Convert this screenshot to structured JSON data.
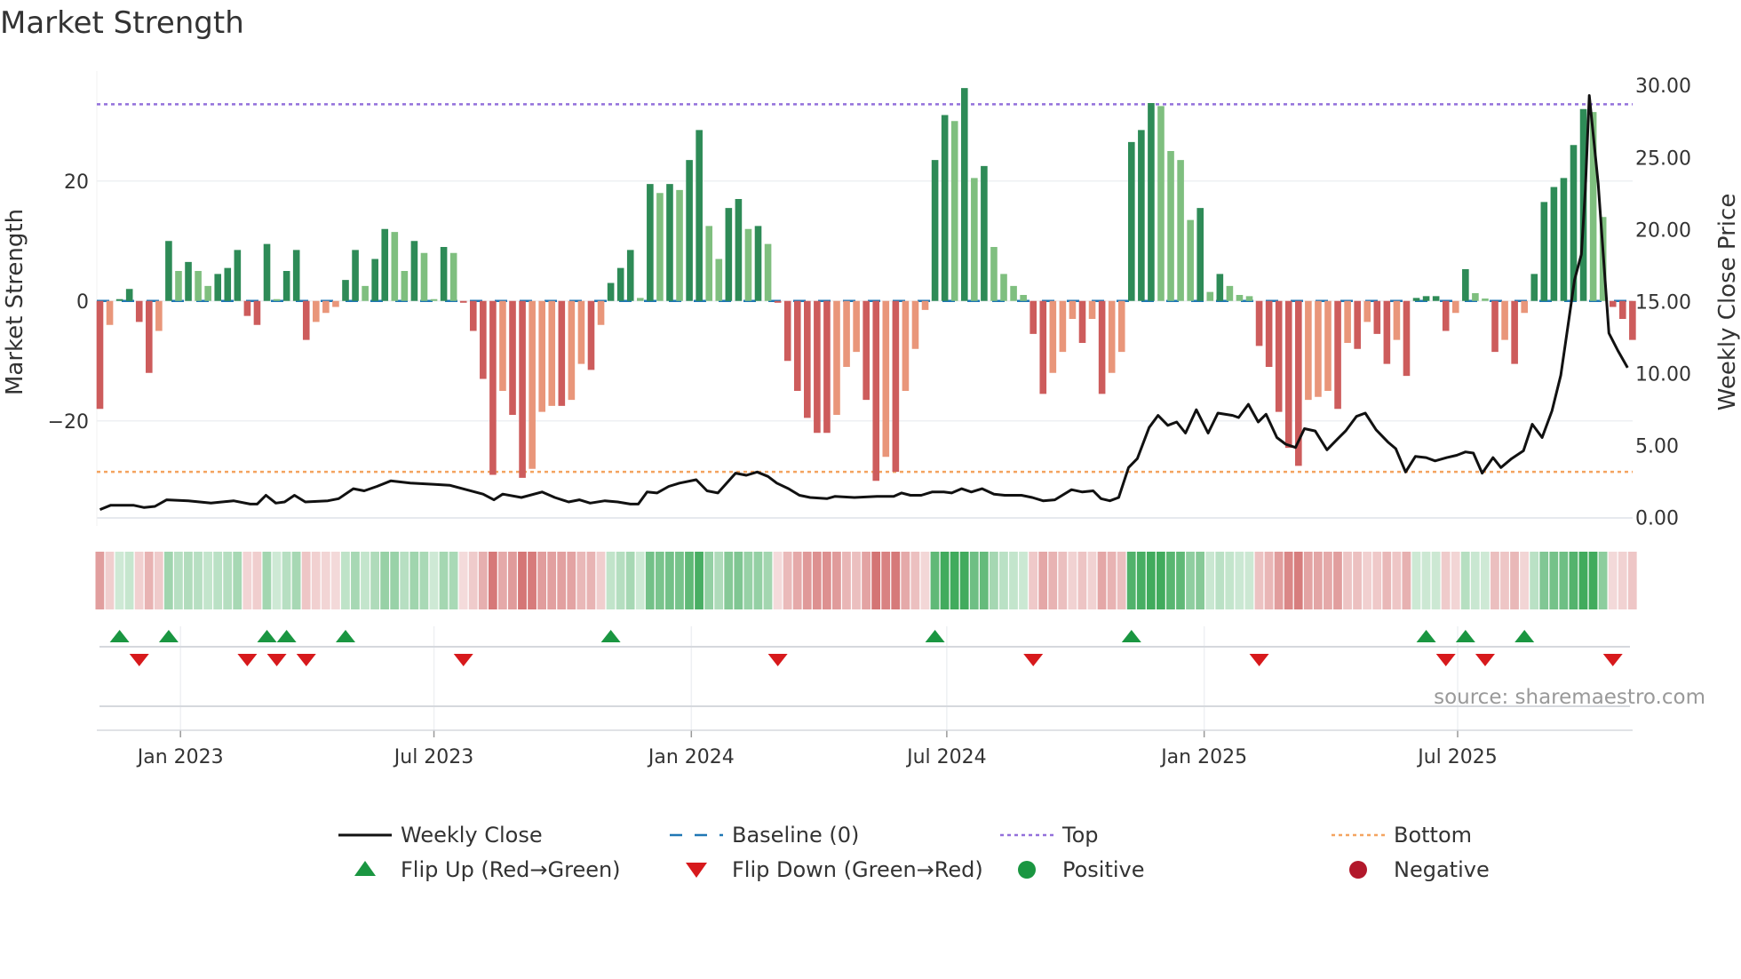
{
  "title": "Market Strength",
  "source": "source: sharemaestro.com",
  "colors": {
    "pos_strong": "#2e8b57",
    "pos_weak": "#7fbf7f",
    "neg_strong": "#cd5c5c",
    "neg_weak": "#e9967a",
    "top": "#9370db",
    "bottom": "#f4a460",
    "baseline": "#1f77b4",
    "close": "#111111",
    "flip_up": "#1a9641",
    "flip_down": "#d7191c"
  },
  "chart_data": {
    "type": "bar+line",
    "title": "Market Strength",
    "ylabel": "Market Strength",
    "y2label": "Weekly Close Price",
    "ylim": [
      -36,
      38
    ],
    "y2lim": [
      0,
      30
    ],
    "yticks": [
      {
        "v": 20,
        "label": "20"
      },
      {
        "v": 0,
        "label": "0"
      },
      {
        "v": -20,
        "label": "−20"
      }
    ],
    "y2ticks": [
      {
        "v": 30,
        "label": "30.00"
      },
      {
        "v": 25,
        "label": "25.00"
      },
      {
        "v": 20,
        "label": "20.00"
      },
      {
        "v": 15,
        "label": "15.00"
      },
      {
        "v": 10,
        "label": "10.00"
      },
      {
        "v": 5,
        "label": "5.00"
      },
      {
        "v": 0,
        "label": "0.00"
      }
    ],
    "xticks": [
      {
        "week": 8.2,
        "label": "Jan 2023"
      },
      {
        "week": 34.0,
        "label": "Jul 2023"
      },
      {
        "week": 60.2,
        "label": "Jan 2024"
      },
      {
        "week": 86.2,
        "label": "Jul 2024"
      },
      {
        "week": 112.4,
        "label": "Jan 2025"
      },
      {
        "week": 138.2,
        "label": "Jul 2025"
      }
    ],
    "top_level": 32.8,
    "bottom_level": -28.5,
    "strength": [
      -18,
      -4,
      0.3,
      2,
      -3.5,
      -12,
      -5,
      10,
      5,
      6.5,
      5,
      2.5,
      4.5,
      5.5,
      8.5,
      -2.5,
      -4,
      9.5,
      0.3,
      5,
      8.5,
      -6.5,
      -3.5,
      -2,
      -1,
      3.5,
      8.5,
      2.5,
      7,
      12,
      11.5,
      5,
      10,
      8,
      0.3,
      9,
      8,
      -0.3,
      -5,
      -13,
      -29,
      -15,
      -19,
      -29.5,
      -28,
      -18.5,
      -17.5,
      -17.5,
      -16.5,
      -10.5,
      -11.5,
      -4,
      3,
      5.5,
      8.5,
      0.5,
      19.5,
      18,
      19.5,
      18.5,
      23.5,
      28.5,
      12.5,
      7,
      15.5,
      17,
      12,
      12.5,
      9.5,
      -0.3,
      -10,
      -15,
      -19.5,
      -22,
      -22,
      -19,
      -11,
      -8.5,
      -16.5,
      -30,
      -26,
      -28.5,
      -15,
      -8,
      -1.5,
      23.5,
      31,
      30,
      35.5,
      20.5,
      22.5,
      9,
      4.5,
      2.5,
      1,
      -5.5,
      -15.5,
      -12,
      -8.5,
      -3,
      -7,
      -3,
      -15.5,
      -12,
      -8.5,
      26.5,
      28.5,
      33,
      32.5,
      25,
      23.5,
      13.5,
      15.5,
      1.5,
      4.5,
      2.5,
      1,
      0.8,
      -7.5,
      -11,
      -18.5,
      -24.5,
      -27.5,
      -16.5,
      -16,
      -15,
      -18,
      -7,
      -8,
      -3.5,
      -5.5,
      -10.5,
      -6.5,
      -12.5,
      0.5,
      0.8,
      0.8,
      -5,
      -2,
      5.3,
      1.3,
      0.4,
      -8.5,
      -6.5,
      -10.5,
      -2,
      4.5,
      16.5,
      19,
      20.5,
      26,
      32,
      31.5,
      14,
      -1,
      -3,
      -6.5
    ],
    "weekly_close": [
      [
        0,
        0.55
      ],
      [
        1.1,
        0.85
      ],
      [
        3.4,
        0.85
      ],
      [
        4.5,
        0.69
      ],
      [
        5.6,
        0.77
      ],
      [
        6.8,
        1.23
      ],
      [
        9,
        1.16
      ],
      [
        11.3,
        1.0
      ],
      [
        13.6,
        1.16
      ],
      [
        15.3,
        0.93
      ],
      [
        16,
        0.93
      ],
      [
        16.9,
        1.54
      ],
      [
        17.9,
        1.0
      ],
      [
        18.8,
        1.08
      ],
      [
        19.8,
        1.54
      ],
      [
        20.9,
        1.08
      ],
      [
        23.2,
        1.16
      ],
      [
        24.3,
        1.31
      ],
      [
        25.8,
        2.0
      ],
      [
        26.9,
        1.85
      ],
      [
        28.2,
        2.16
      ],
      [
        29.6,
        2.54
      ],
      [
        31.6,
        2.39
      ],
      [
        33.9,
        2.31
      ],
      [
        35.6,
        2.24
      ],
      [
        37.3,
        1.93
      ],
      [
        39,
        1.62
      ],
      [
        40.1,
        1.23
      ],
      [
        41,
        1.62
      ],
      [
        42.9,
        1.39
      ],
      [
        45,
        1.77
      ],
      [
        46.3,
        1.39
      ],
      [
        47.7,
        1.08
      ],
      [
        48.8,
        1.23
      ],
      [
        49.9,
        1.0
      ],
      [
        51.4,
        1.16
      ],
      [
        52.7,
        1.08
      ],
      [
        54,
        0.93
      ],
      [
        54.8,
        0.93
      ],
      [
        55.7,
        1.77
      ],
      [
        56.7,
        1.7
      ],
      [
        57.9,
        2.16
      ],
      [
        59,
        2.39
      ],
      [
        60.7,
        2.62
      ],
      [
        61.8,
        1.85
      ],
      [
        62.9,
        1.7
      ],
      [
        64.7,
        3.08
      ],
      [
        65.8,
        2.93
      ],
      [
        66.9,
        3.16
      ],
      [
        68,
        2.85
      ],
      [
        68.9,
        2.39
      ],
      [
        70.1,
        2.0
      ],
      [
        71.2,
        1.54
      ],
      [
        72.3,
        1.39
      ],
      [
        74,
        1.31
      ],
      [
        74.8,
        1.46
      ],
      [
        76.8,
        1.39
      ],
      [
        79.1,
        1.46
      ],
      [
        80.8,
        1.46
      ],
      [
        81.6,
        1.7
      ],
      [
        82.5,
        1.54
      ],
      [
        83.6,
        1.54
      ],
      [
        84.7,
        1.77
      ],
      [
        85.9,
        1.77
      ],
      [
        86.7,
        1.7
      ],
      [
        87.7,
        2.0
      ],
      [
        88.7,
        1.77
      ],
      [
        89.8,
        2.0
      ],
      [
        91,
        1.62
      ],
      [
        92.1,
        1.54
      ],
      [
        93.8,
        1.54
      ],
      [
        94.9,
        1.39
      ],
      [
        96,
        1.16
      ],
      [
        97.2,
        1.23
      ],
      [
        98.9,
        1.93
      ],
      [
        100,
        1.77
      ],
      [
        101.1,
        1.85
      ],
      [
        101.9,
        1.31
      ],
      [
        102.8,
        1.16
      ],
      [
        103.7,
        1.39
      ],
      [
        104.7,
        3.47
      ],
      [
        105.6,
        4.09
      ],
      [
        106.8,
        6.25
      ],
      [
        107.7,
        7.09
      ],
      [
        108.7,
        6.4
      ],
      [
        109.6,
        6.63
      ],
      [
        110.5,
        5.86
      ],
      [
        111.6,
        7.48
      ],
      [
        112.8,
        5.86
      ],
      [
        113.8,
        7.25
      ],
      [
        115.3,
        7.09
      ],
      [
        115.9,
        6.94
      ],
      [
        116.9,
        7.86
      ],
      [
        117.9,
        6.63
      ],
      [
        118.7,
        7.17
      ],
      [
        119.8,
        5.55
      ],
      [
        120.7,
        5.09
      ],
      [
        121.7,
        4.86
      ],
      [
        122.6,
        6.17
      ],
      [
        123.7,
        6.01
      ],
      [
        124.9,
        4.7
      ],
      [
        126,
        5.47
      ],
      [
        126.8,
        6.01
      ],
      [
        127.9,
        7.02
      ],
      [
        128.8,
        7.25
      ],
      [
        129.9,
        6.09
      ],
      [
        131.1,
        5.24
      ],
      [
        131.9,
        4.78
      ],
      [
        132.9,
        3.16
      ],
      [
        133.9,
        4.24
      ],
      [
        135,
        4.16
      ],
      [
        135.9,
        3.93
      ],
      [
        137.1,
        4.16
      ],
      [
        138.1,
        4.32
      ],
      [
        139,
        4.55
      ],
      [
        139.8,
        4.47
      ],
      [
        140.7,
        3.08
      ],
      [
        141.8,
        4.16
      ],
      [
        142.6,
        3.47
      ],
      [
        143.7,
        4.09
      ],
      [
        144.9,
        4.63
      ],
      [
        145.8,
        6.48
      ],
      [
        146.8,
        5.55
      ],
      [
        147.8,
        7.4
      ],
      [
        148.7,
        9.87
      ],
      [
        149.4,
        13.18
      ],
      [
        150.1,
        16.5
      ],
      [
        150.8,
        18.27
      ],
      [
        151.2,
        22.82
      ],
      [
        151.6,
        29.3
      ],
      [
        152.5,
        23.2
      ],
      [
        153.6,
        12.8
      ],
      [
        154.5,
        11.6
      ],
      [
        155.5,
        10.4
      ]
    ],
    "flip_up_weeks": [
      2,
      7,
      17,
      19,
      25,
      52,
      85,
      105,
      135,
      139,
      145
    ],
    "flip_down_weeks": [
      4,
      15,
      18,
      21,
      37,
      69,
      95,
      118,
      137,
      141,
      154
    ],
    "legend": [
      "Weekly Close",
      "Baseline (0)",
      "Top",
      "Bottom",
      "Flip Up (Red→Green)",
      "Flip Down (Green→Red)",
      "Positive",
      "Negative"
    ],
    "legend_placement": "bottom"
  }
}
